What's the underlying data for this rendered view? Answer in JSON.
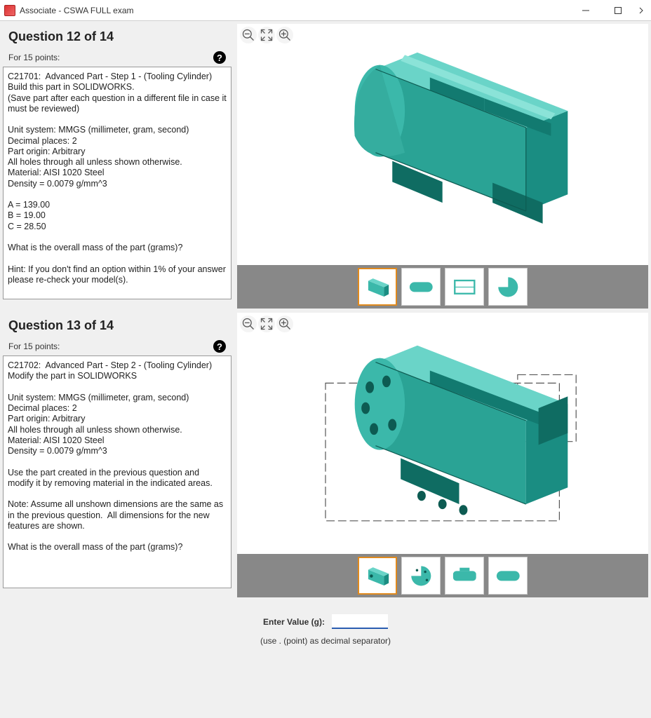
{
  "window": {
    "title": "Associate - CSWA FULL exam"
  },
  "q12": {
    "header": "Question 12 of 14",
    "points": "For 15 points:",
    "body": "C21701:  Advanced Part - Step 1 - (Tooling Cylinder)\nBuild this part in SOLIDWORKS.\n(Save part after each question in a different file in case it must be reviewed)\n\nUnit system: MMGS (millimeter, gram, second)\nDecimal places: 2\nPart origin: Arbitrary\nAll holes through all unless shown otherwise.\nMaterial: AISI 1020 Steel\nDensity = 0.0079 g/mm^3\n\nA = 139.00\nB = 19.00\nC = 28.50\n\nWhat is the overall mass of the part (grams)?\n\nHint: If you don't find an option within 1% of your answer please re-check your model(s)."
  },
  "q13": {
    "header": "Question 13 of 14",
    "points": "For 15 points:",
    "body": "C21702:  Advanced Part - Step 2 - (Tooling Cylinder)\nModify the part in SOLIDWORKS\n\nUnit system: MMGS (millimeter, gram, second)\nDecimal places: 2\nPart origin: Arbitrary\nAll holes through all unless shown otherwise.\nMaterial: AISI 1020 Steel\nDensity = 0.0079 g/mm^3\n\nUse the part created in the previous question and modify it by removing material in the indicated areas.\n\nNote: Assume all unshown dimensions are the same as in the previous question.  All dimensions for the new features are shown.\n\nWhat is the overall mass of the part (grams)?"
  },
  "answer": {
    "label": "Enter Value (g):",
    "value": "",
    "hint": "(use . (point) as decimal separator)"
  },
  "colors": {
    "part": "#3bb8aa",
    "part_dark": "#1a8d82",
    "part_light": "#6ad4c8",
    "thumb_selected": "#e08a1e"
  }
}
